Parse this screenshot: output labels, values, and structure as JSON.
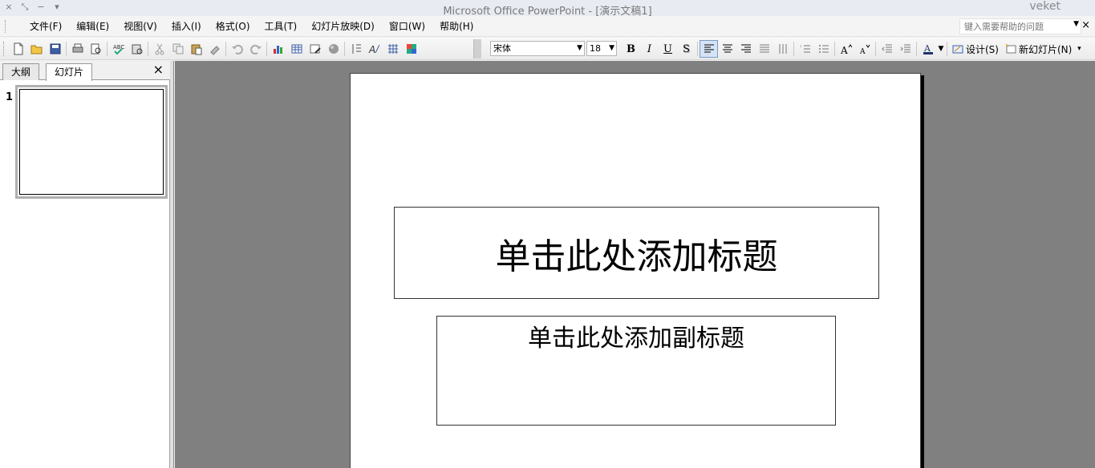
{
  "window": {
    "title": "Microsoft Office PowerPoint - [演示文稿1]",
    "brand": "veket",
    "controls": [
      "×",
      "⤡",
      "−",
      "▾"
    ]
  },
  "menu": {
    "items": [
      "文件(F)",
      "编辑(E)",
      "视图(V)",
      "插入(I)",
      "格式(O)",
      "工具(T)",
      "幻灯片放映(D)",
      "窗口(W)",
      "帮助(H)"
    ],
    "help_placeholder": "键入需要帮助的问题",
    "close_glyph": "×"
  },
  "toolbar": {
    "font_name": "宋体",
    "font_size": "18",
    "bold": "B",
    "italic": "I",
    "underline": "U",
    "shadow": "S",
    "design_label": "设计(S)",
    "new_slide_label": "新幻灯片(N)",
    "icons": [
      "new-icon",
      "open-icon",
      "save-icon",
      "print-icon",
      "print-preview-icon",
      "spelling-icon",
      "research-icon",
      "cut-icon",
      "copy-icon",
      "paste-icon",
      "format-painter-icon",
      "undo-icon",
      "redo-icon",
      "chart-icon",
      "table-icon",
      "tables-borders-icon",
      "color-icon",
      "expand-icon",
      "show-formatting-icon",
      "grid-icon",
      "color-grayscale-icon"
    ]
  },
  "left_pane": {
    "tab_outline": "大纲",
    "tab_slides": "幻灯片",
    "close_glyph": "×",
    "slide_number": "1"
  },
  "slide": {
    "title_placeholder": "单击此处添加标题",
    "subtitle_placeholder": "单击此处添加副标题"
  },
  "colors": {
    "workspace": "#808080",
    "accent": "#d6e3f5"
  }
}
